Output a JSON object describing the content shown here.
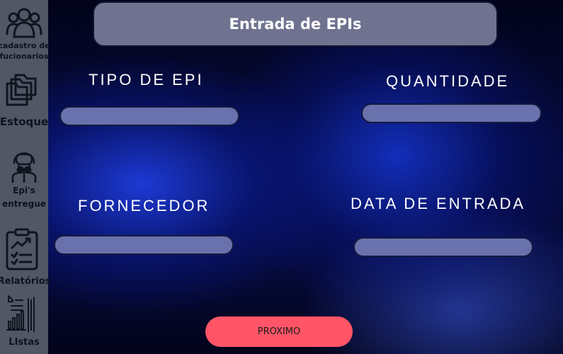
{
  "sidebar": {
    "items": [
      {
        "label_line1": "cadastro de",
        "label_line2": "fucionarios",
        "icon": "users-icon"
      },
      {
        "label": "Estoque",
        "icon": "folders-icon"
      },
      {
        "label_line1": "Epi's",
        "label_line2": "entregue",
        "icon": "hazmat-worker-icon"
      },
      {
        "label": "Relatórios",
        "icon": "clipboard-chart-icon"
      },
      {
        "label": "LIstas",
        "icon": "report-chart-icon"
      }
    ]
  },
  "header": {
    "title": "Entrada de EPIs"
  },
  "form": {
    "tipo_label": "TIPO DE EPI",
    "tipo_value": "",
    "quantidade_label": "QUANTIDADE",
    "quantidade_value": "",
    "fornecedor_label": "FORNECEDOR",
    "fornecedor_value": "",
    "data_label": "DATA DE ENTRADA",
    "data_value": ""
  },
  "actions": {
    "next_label": "PROXIMO"
  },
  "colors": {
    "sidebar_bg": "#525766",
    "title_bg": "#6f7390",
    "input_bg": "#6a72ad",
    "button_bg": "#ff5567"
  }
}
